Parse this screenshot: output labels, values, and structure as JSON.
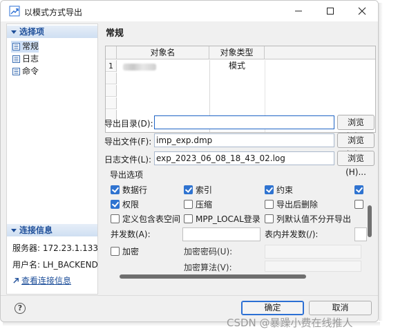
{
  "window": {
    "title": "以模式方式导出"
  },
  "sidebar": {
    "section_title": "选择项",
    "items": [
      {
        "label": "常规",
        "selected": true
      },
      {
        "label": "日志",
        "selected": false
      },
      {
        "label": "命令",
        "selected": false
      }
    ],
    "connection": {
      "title": "连接信息",
      "server": "服务器: 172.23.1.133",
      "user": "用户名: LH_BACKEND",
      "view_link": "查看连接信息"
    }
  },
  "main": {
    "title": "常规",
    "table": {
      "columns": [
        "对象名",
        "对象类型"
      ],
      "rows": [
        {
          "no": "1",
          "name": "",
          "type": "模式"
        }
      ]
    },
    "fields": {
      "dir_label": "导出目录(D):",
      "dir_value": "",
      "dir_browse": "浏览(B)...",
      "file_label": "导出文件(F):",
      "file_value": "imp_exp.dmp",
      "file_browse": "浏览(R)...",
      "log_label": "日志文件(L):",
      "log_value": "exp_2023_06_08_18_43_02.log",
      "log_browse": "浏览(H)..."
    },
    "options": {
      "title": "导出选项",
      "row1": [
        {
          "label": "数据行",
          "checked": true
        },
        {
          "label": "索引",
          "checked": true
        },
        {
          "label": "约束",
          "checked": true
        }
      ],
      "row2": [
        {
          "label": "权限",
          "checked": true
        },
        {
          "label": "压缩",
          "checked": false
        },
        {
          "label": "导出后删除",
          "checked": false
        }
      ],
      "row3": [
        {
          "label": "定义包含表空间",
          "checked": false
        },
        {
          "label": "MPP_LOCAL登录",
          "checked": false
        },
        {
          "label": "列默认值不分开导出",
          "checked": false
        }
      ],
      "parallel_label": "并发数(A):",
      "table_parallel_label": "表内并发数(/):",
      "encrypt_label": "加密",
      "encrypt_password_label": "加密密码(U):",
      "encrypt_algo_label": "加密算法(V):"
    }
  },
  "footer": {
    "help": "?",
    "ok": "确定",
    "cancel": "取消"
  },
  "watermark": "CSDN @暴躁小费在线推人",
  "colors": {
    "accent": "#2f73d0",
    "section_text": "#1e4f9a"
  }
}
